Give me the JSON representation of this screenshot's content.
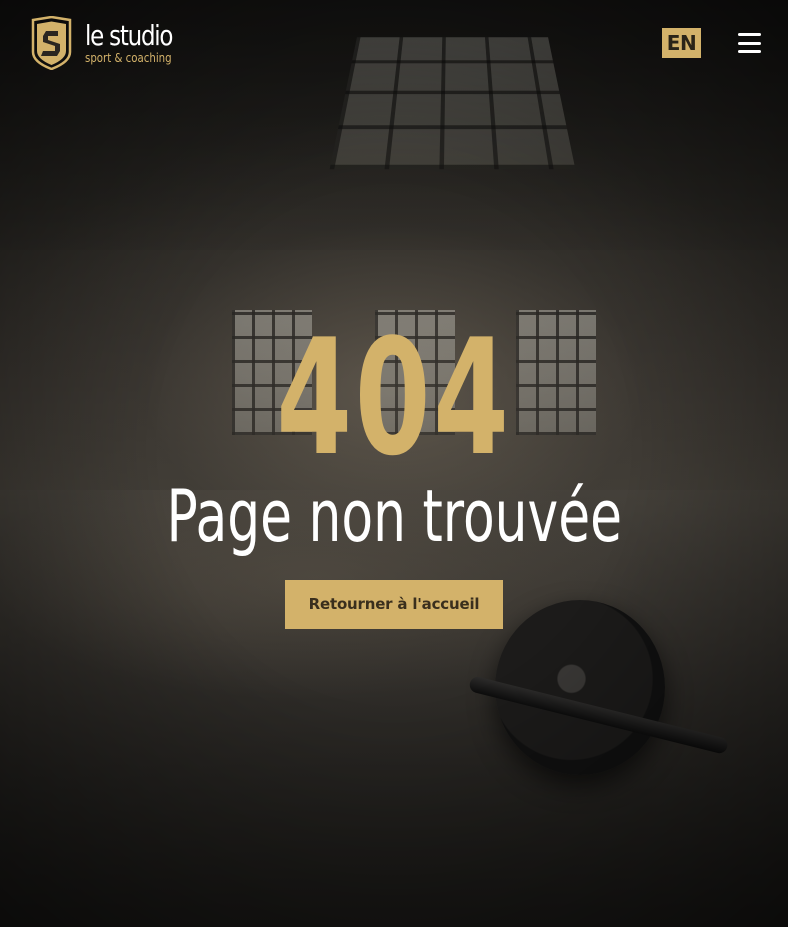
{
  "brand": {
    "name": "le studio",
    "tagline": "sport & coaching",
    "accent_color": "#d3b26a"
  },
  "header": {
    "language_label": "EN",
    "menu_icon": "hamburger-menu-icon"
  },
  "error": {
    "code": "404",
    "message": "Page non trouvée",
    "home_button_label": "Retourner à l'accueil"
  }
}
